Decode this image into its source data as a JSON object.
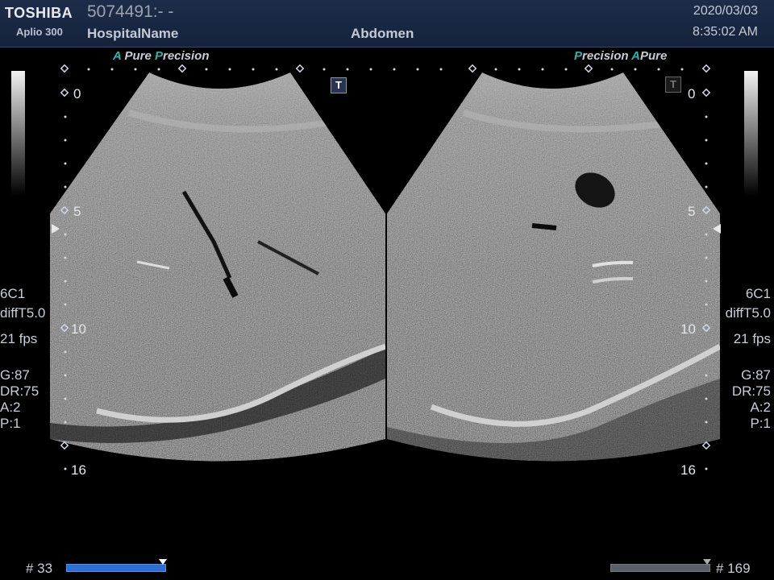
{
  "header": {
    "brand": "TOSHIBA",
    "model": "Aplio 300",
    "patient_id": "5074491:- -",
    "hospital": "HospitalName",
    "region": "Abdomen",
    "date": "2020/03/03",
    "time": "8:35:02 AM"
  },
  "taglines": {
    "left": {
      "a": "A",
      "pure": " Pure ",
      "p": "P",
      "precision": "recision"
    },
    "right": {
      "p": "P",
      "precision": "recision ",
      "a": "A",
      "pure": "Pure"
    }
  },
  "depth_scale": {
    "labels": [
      "0",
      "5",
      "10",
      "16"
    ]
  },
  "left_params": {
    "probe": "6C1",
    "preset": "diffT5.0",
    "fps": "21 fps",
    "gain": "G:87",
    "dr": "DR:75",
    "a": "A:2",
    "p": "P:1"
  },
  "right_params": {
    "probe": "6C1",
    "preset": "diffT5.0",
    "fps": "21 fps",
    "gain": "G:87",
    "dr": "DR:75",
    "a": "A:2",
    "p": "P:1"
  },
  "footer": {
    "left_frame": "# 33",
    "right_frame": "# 169",
    "left_progress": 1.0,
    "right_progress": 1.0
  },
  "t_label": "T",
  "colors": {
    "header_bg": "#1a2943",
    "accent": "#2db6a8",
    "progress_active": "#2a6fd6",
    "progress_inactive": "#5a5f68"
  }
}
